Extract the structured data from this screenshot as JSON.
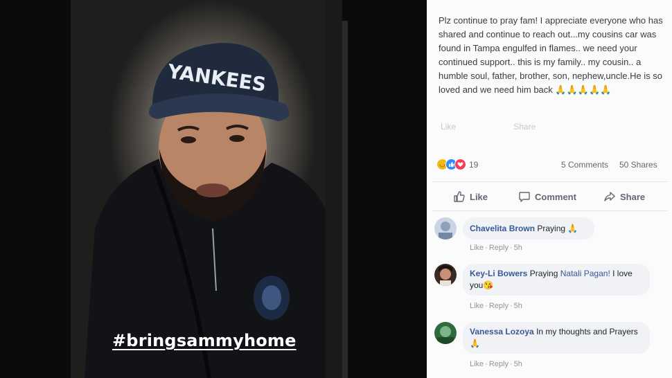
{
  "photo": {
    "hashtag": "#bringsammyhome",
    "cap_text": "YANKEES"
  },
  "post": {
    "text": "Plz continue to pray fam! I appreciate everyone who has shared and continue to reach out...my cousins car was found in Tampa engulfed in flames.. we need your continued support.. this is my family.. my cousin.. a humble soul, father, brother, son, nephew,uncle.He is so loved and we need him back 🙏🙏🙏🙏🙏",
    "ghost_like": "Like",
    "ghost_share": "Share",
    "reactions": {
      "sad_icon": "sad-reaction",
      "like_icon": "like-reaction",
      "love_icon": "love-reaction",
      "count": "19"
    },
    "comments_count": "5 Comments",
    "shares_count": "50 Shares",
    "actions": {
      "like": "Like",
      "comment": "Comment",
      "share": "Share"
    }
  },
  "comments": [
    {
      "name": "Chavelita Brown",
      "text": "Praying 🙏",
      "like": "Like",
      "reply": "Reply",
      "time": "5h"
    },
    {
      "name": "Key-Li Bowers",
      "text_before": "Praying",
      "tag": "Natali Pagan!",
      "text_after": "I love you😘",
      "like": "Like",
      "reply": "Reply",
      "time": "5h"
    },
    {
      "name": "Vanessa Lozoya",
      "text": "In my thoughts and Prayers 🙏",
      "like": "Like",
      "reply": "Reply",
      "time": "5h"
    }
  ],
  "colors": {
    "link_blue": "#385898",
    "like_blue": "#2d88ff",
    "love_red": "#f33e58",
    "sad_yellow": "#f0ba15"
  }
}
